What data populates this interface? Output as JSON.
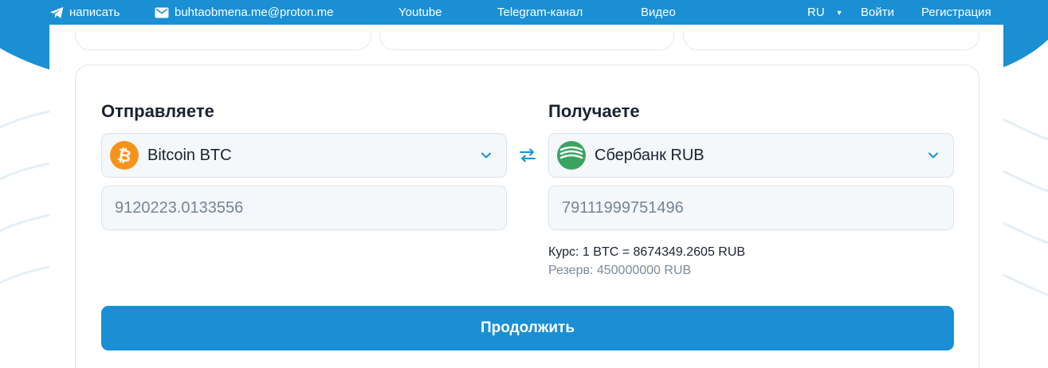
{
  "nav": {
    "write": "написать",
    "email": "buhtaobmena.me@proton.me",
    "youtube": "Youtube",
    "telegram": "Telegram-канал",
    "video": "Видео",
    "lang": "RU",
    "login": "Войти",
    "register": "Регистрация"
  },
  "send": {
    "title": "Отправляете",
    "currency": "Bitcoin BTC",
    "amount": "9120223.0133556"
  },
  "receive": {
    "title": "Получаете",
    "currency": "Сбербанк RUB",
    "account": "79111999751496",
    "rate": "Курс: 1 BTC = 8674349.2605 RUB",
    "reserve": "Резерв: 450000000 RUB"
  },
  "continue_label": "Продолжить",
  "colors": {
    "accent": "#1a8fd3",
    "bitcoin": "#f7931a",
    "sber": "#3aa360"
  },
  "icons": [
    "telegram-icon",
    "mail-icon",
    "caret-down-icon",
    "bitcoin-icon",
    "sberbank-icon",
    "chevron-down-icon",
    "swap-icon"
  ]
}
